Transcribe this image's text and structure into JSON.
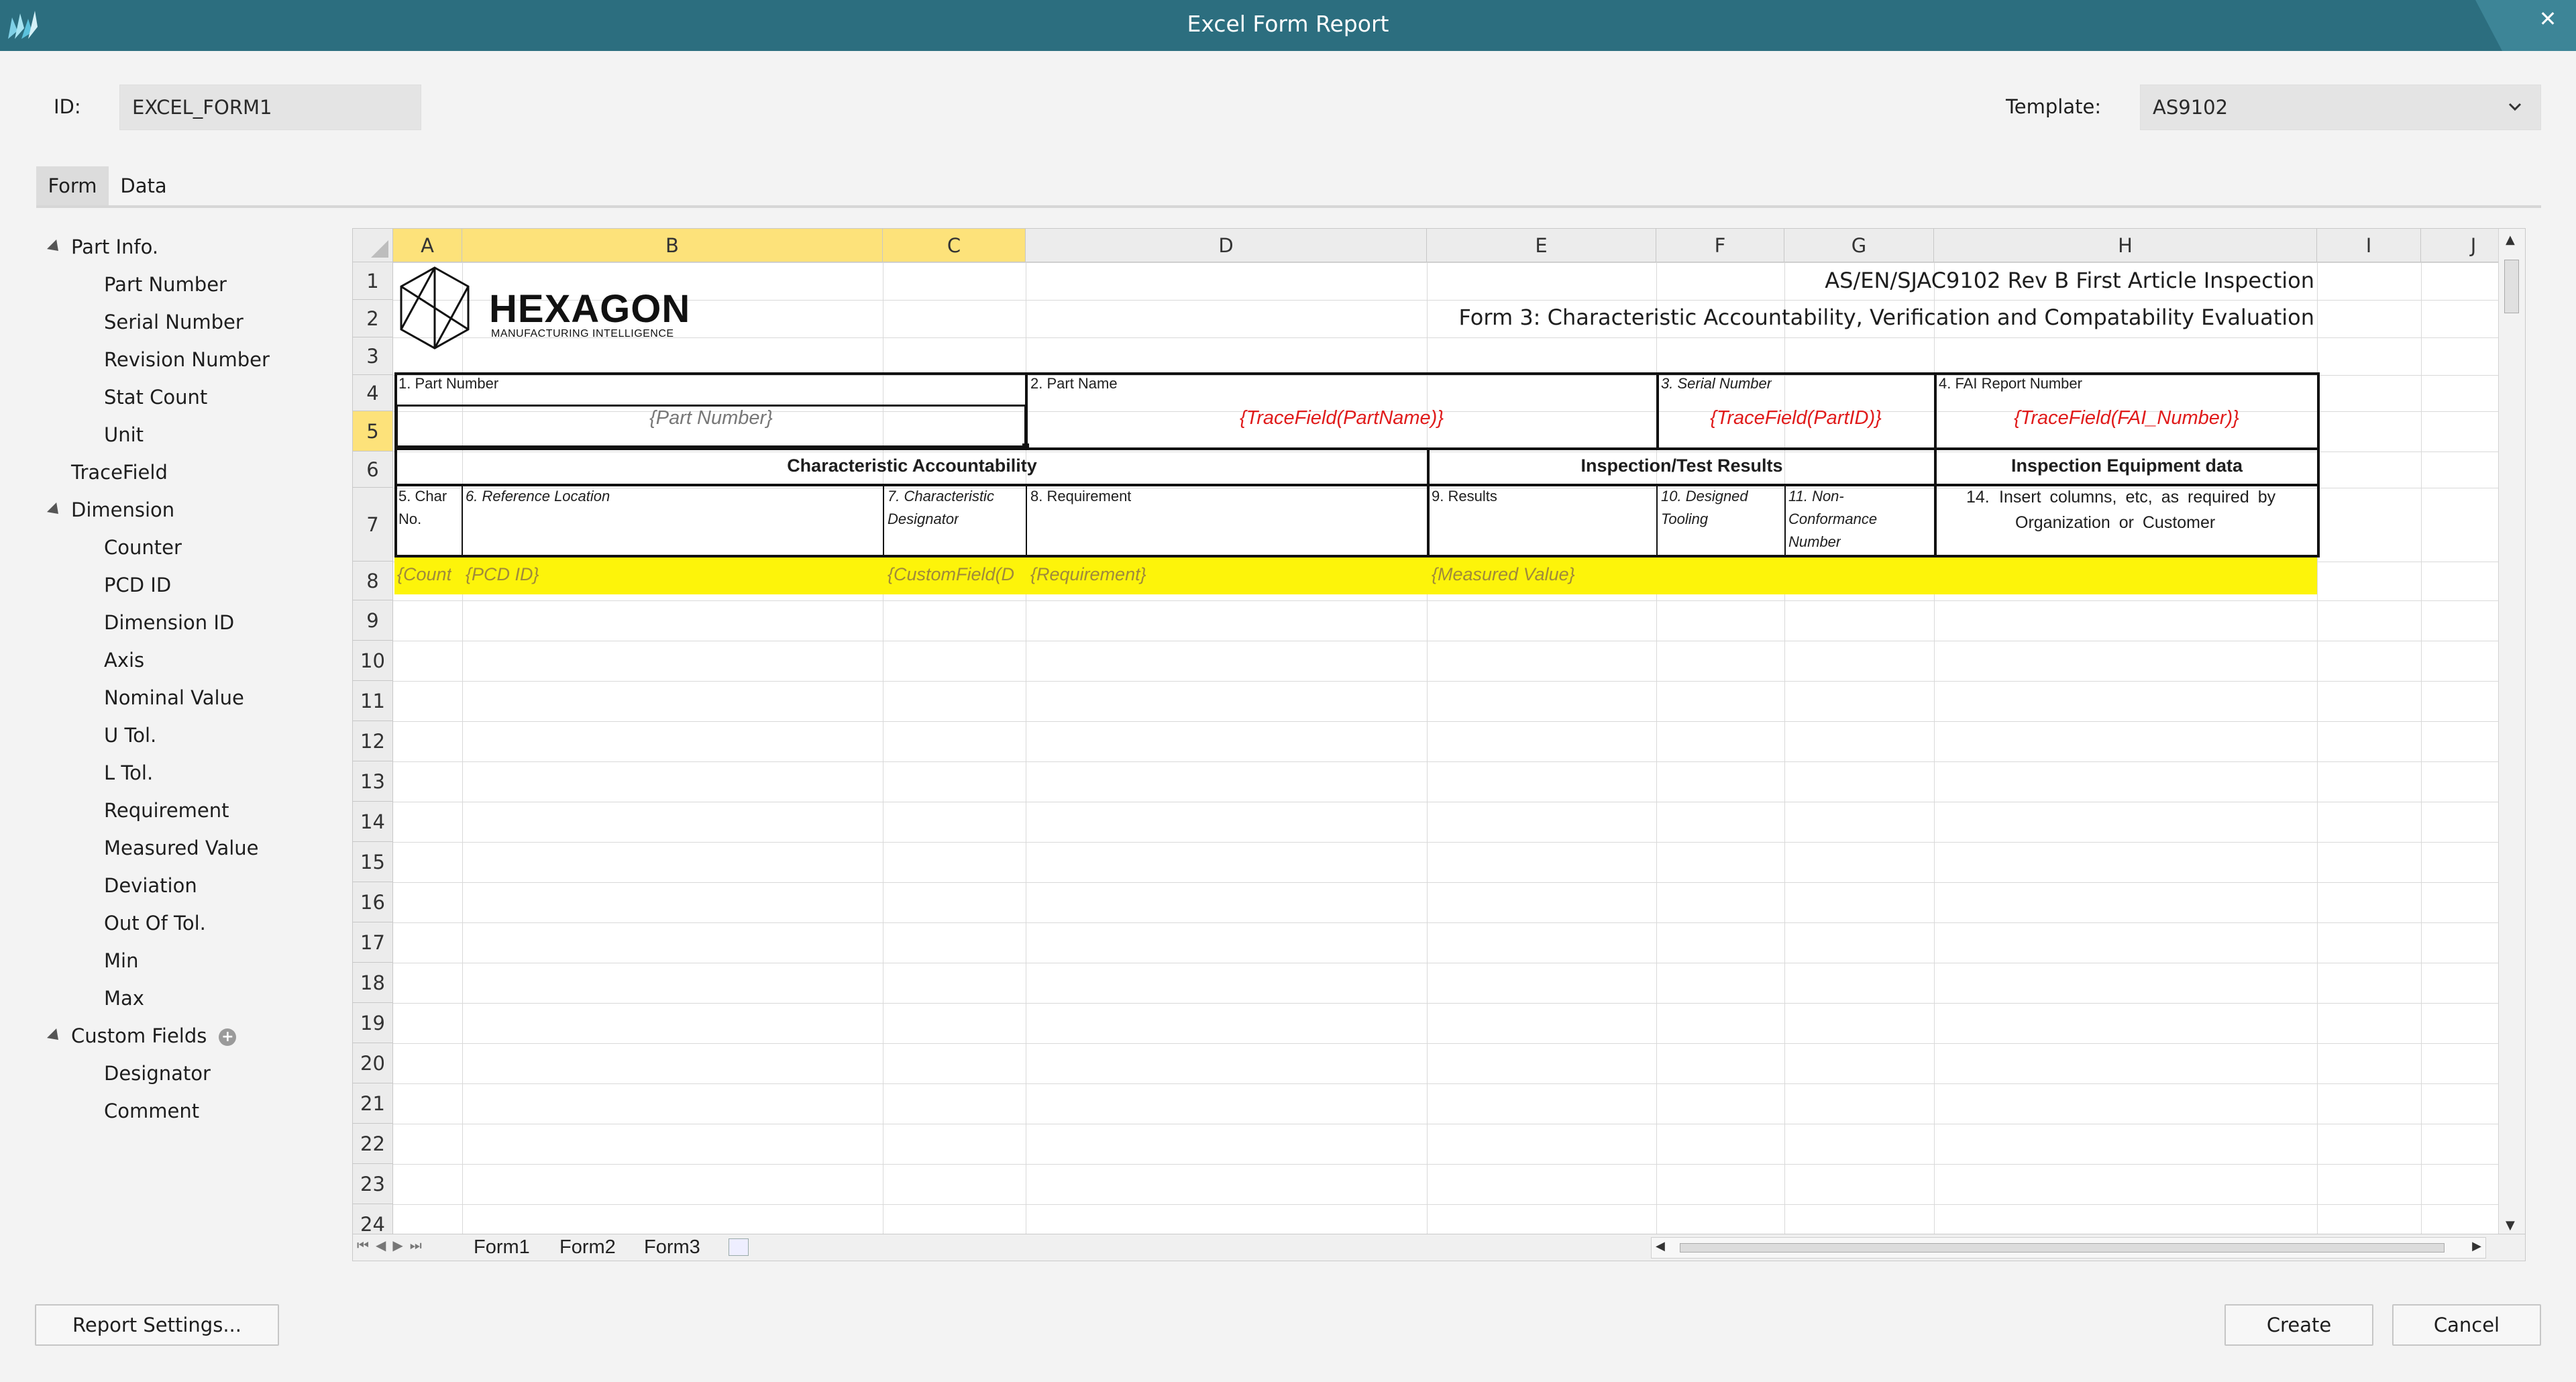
{
  "window": {
    "title": "Excel Form Report"
  },
  "header": {
    "id_label": "ID:",
    "id_value": "EXCEL_FORM1",
    "template_label": "Template:",
    "template_value": "AS9102"
  },
  "tabs": [
    {
      "label": "Form"
    },
    {
      "label": "Data"
    }
  ],
  "tree": {
    "groups": [
      {
        "label": "Part Info.",
        "children": [
          "Part Number",
          "Serial Number",
          "Revision Number",
          "Stat Count",
          "Unit"
        ]
      },
      {
        "label": "TraceField",
        "children": []
      },
      {
        "label": "Dimension",
        "children": [
          "Counter",
          "PCD ID",
          "Dimension ID",
          "Axis",
          "Nominal Value",
          "U Tol.",
          "L Tol.",
          "Requirement",
          "Measured Value",
          "Deviation",
          "Out Of Tol.",
          "Min",
          "Max"
        ]
      },
      {
        "label": "Custom Fields",
        "children": [
          "Designator",
          "Comment"
        ]
      }
    ]
  },
  "spreadsheet": {
    "columns": [
      "A",
      "B",
      "C",
      "D",
      "E",
      "F",
      "G",
      "H",
      "I",
      "J"
    ],
    "rows": [
      "1",
      "2",
      "3",
      "4",
      "5",
      "6",
      "7",
      "8",
      "9",
      "10",
      "11",
      "12",
      "13",
      "14",
      "15",
      "16",
      "17",
      "18",
      "19",
      "20",
      "21",
      "22",
      "23",
      "24"
    ],
    "logo": {
      "name": "HEXAGON",
      "tagline": "MANUFACTURING INTELLIGENCE"
    },
    "title1": "AS/EN/SJAC9102 Rev B First Article Inspection",
    "title2": "Form 3: Characteristic Accountability, Verification and Compatability Evaluation",
    "r4": {
      "part_number": "1. Part Number",
      "part_name": "2. Part Name",
      "serial_number": "3. Serial Number",
      "fai_report": "4. FAI Report Number"
    },
    "r5": {
      "part_number": "{Part Number}",
      "part_name": "{TraceField(PartName)}",
      "part_id": "{TraceField(PartID)}",
      "fai_number": "{TraceField(FAI_Number)}"
    },
    "r6": {
      "char_acc": "Characteristic Accountability",
      "results": "Inspection/Test Results",
      "equip": "Inspection Equipment data"
    },
    "r7": {
      "char_no_1": "5. Char",
      "char_no_2": "No.",
      "ref_loc": "6. Reference Location",
      "designator_1": "7. Characteristic",
      "designator_2": "Designator",
      "requirement": "8. Requirement",
      "results": "9. Results",
      "tooling_1": "10. Designed",
      "tooling_2": "Tooling",
      "ncr_1": "11. Non-",
      "ncr_2": "Conformance",
      "ncr_3": "Number",
      "note_num": "14.",
      "note_1": "Insert columns, etc, as required by",
      "note_2": "Organization or Customer"
    },
    "r8": {
      "count": "{Count",
      "pcd": "{PCD ID}",
      "custom": "{CustomField(D",
      "req": "{Requirement}",
      "measured": "{Measured Value}"
    },
    "sheet_tabs": [
      "Form1",
      "Form2",
      "Form3"
    ]
  },
  "buttons": {
    "report_settings": "Report Settings...",
    "create": "Create",
    "cancel": "Cancel"
  },
  "colors": {
    "titlebar": "#2c6e7f",
    "highlight_row": "#fdf40a",
    "red_text": "#e01b1b",
    "selected_header": "#fde27a"
  }
}
